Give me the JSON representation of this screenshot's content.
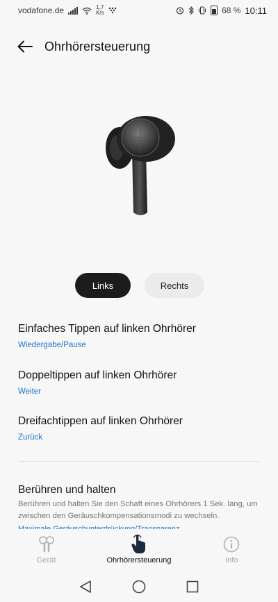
{
  "status_bar": {
    "carrier": "vodafone.de",
    "speed_value": "1,7",
    "speed_unit": "K/s",
    "battery": "68 %",
    "time": "10:11"
  },
  "header": {
    "title": "Ohrhörersteuerung",
    "back_icon": "arrow-left-icon"
  },
  "side_toggle": {
    "left_label": "Links",
    "right_label": "Rechts",
    "selected": "Links"
  },
  "settings": [
    {
      "title": "Einfaches Tippen auf linken Ohrhörer",
      "value": "Wiedergabe/Pause"
    },
    {
      "title": "Doppeltippen auf linken Ohrhörer",
      "value": "Weiter"
    },
    {
      "title": "Dreifachtippen auf linken Ohrhörer",
      "value": "Zurück"
    }
  ],
  "touch_hold": {
    "title": "Berühren und halten",
    "description": "Berühren und halten Sie den Schaft eines Ohrhörers 1 Sek. lang, um zwischen den Geräuschkompensationsmodi zu wechseln.",
    "value": "Maximale Geräuschunterdrückung/Transparenz"
  },
  "tabs": [
    {
      "label": "Gerät",
      "icon": "earbuds-icon",
      "active": false
    },
    {
      "label": "Ohrhörersteuerung",
      "icon": "touch-hand-icon",
      "active": true
    },
    {
      "label": "Info",
      "icon": "info-icon",
      "active": false
    }
  ],
  "colors": {
    "accent_blue": "#1a74d2",
    "active_toggle": "#1c1c1e",
    "background": "#f7f7f7"
  }
}
